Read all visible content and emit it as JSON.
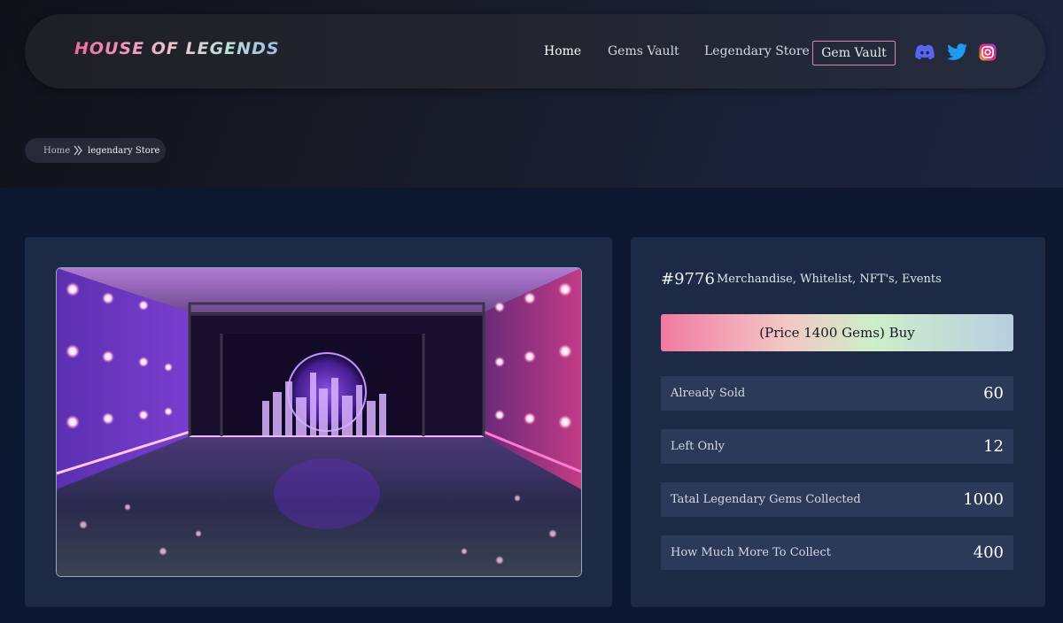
{
  "brand": {
    "logo_text": "HOUSE OF LEGENDS"
  },
  "nav": {
    "links": [
      {
        "label": "Home"
      },
      {
        "label": "Gems Vault"
      },
      {
        "label": "Legendary Store"
      }
    ],
    "button_label": "Gem Vault",
    "social_icons": [
      "discord-icon",
      "twitter-icon",
      "instagram-icon"
    ]
  },
  "breadcrumb": {
    "home": "Home",
    "current": "legendary Store"
  },
  "product": {
    "id": "#9776",
    "tags": "Merchandise, Whitelist, NFT's, Events",
    "buy_label": "(Price 1400 Gems) Buy",
    "stats": [
      {
        "label": "Already Sold",
        "value": "60"
      },
      {
        "label": "Left Only",
        "value": "12"
      },
      {
        "label": "Tatal Legendary Gems Collected",
        "value": "1000"
      },
      {
        "label": "How Much More To Collect",
        "value": "400"
      }
    ]
  },
  "colors": {
    "accent_pink": "#ee6aa2",
    "card_bg": "#1d2a45",
    "stat_bg": "#2b3a59",
    "discord": "#5865f2",
    "twitter": "#1d9bf0"
  }
}
